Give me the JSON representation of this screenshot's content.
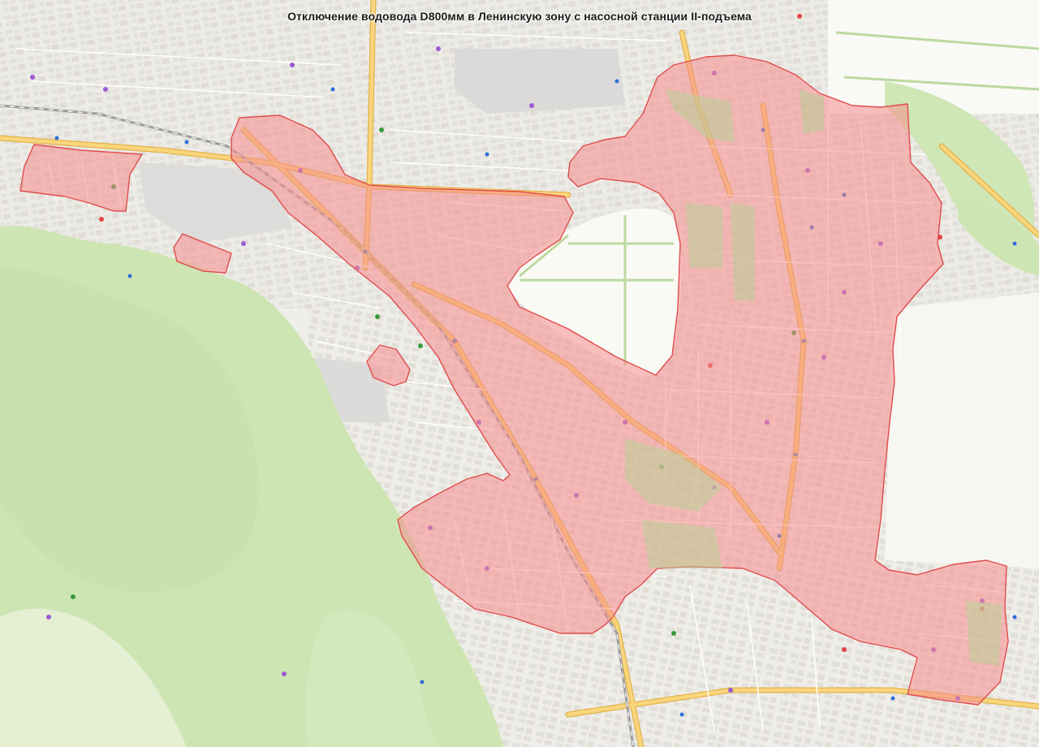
{
  "map": {
    "title": "Отключение водовода D800мм в Ленинскую зону с насосной станции II-подъема",
    "colors": {
      "background": "#f2f1ec",
      "forest": "#cfe6b6",
      "forest_light": "#e2efcf",
      "field": "#fbfbf7",
      "fence": "#b9d89b",
      "urban": "#e4e1dc",
      "industrial": "#d9d7d5",
      "road_major": "#f7d27a",
      "road_major_casing": "#e6b449",
      "road_minor": "#ffffff",
      "railway": "#a9a9a9",
      "zone_fill": "#f58c8c",
      "zone_stroke": "#e04c4c",
      "poi_purple": "#9b59d6",
      "poi_blue": "#2e6fd8",
      "poi_red": "#e34545",
      "poi_green": "#3a9a3a"
    },
    "zones": [
      "outage-zone-main",
      "outage-zone-west",
      "outage-zone-small-west",
      "outage-zone-center",
      "outage-zone-southeast"
    ]
  }
}
